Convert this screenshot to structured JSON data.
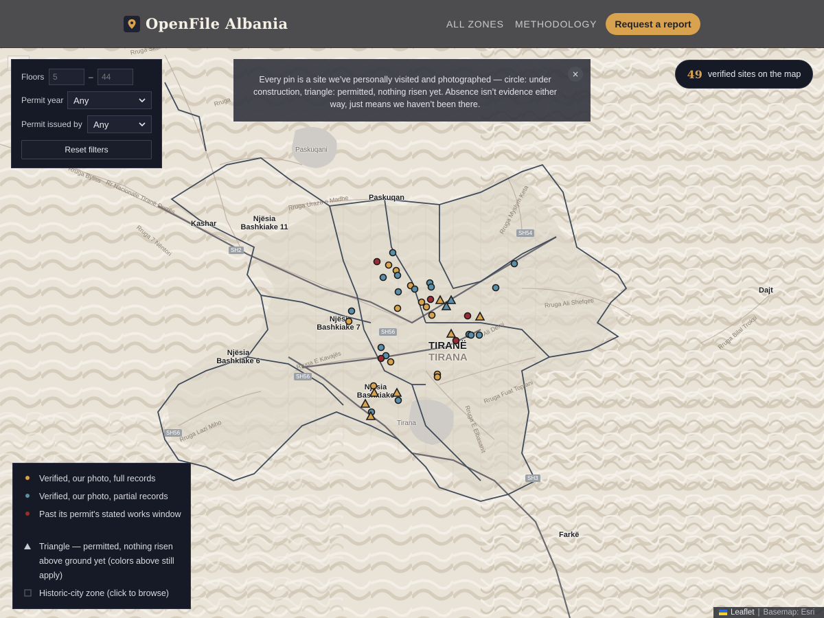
{
  "header": {
    "brand": "OpenFile Albania",
    "nav": [
      {
        "label": "ALL ZONES"
      },
      {
        "label": "METHODOLOGY"
      }
    ],
    "cta": "Request a report",
    "colors": {
      "bar": "#4d4d4f",
      "accent": "#d9a24e"
    }
  },
  "filters": {
    "floors_label": "Floors",
    "floors_min_placeholder": "5",
    "floors_sep": "–",
    "floors_max_placeholder": "44",
    "permit_year_label": "Permit year",
    "permit_year_value": "Any",
    "permit_issued_label": "Permit issued by",
    "permit_issued_value": "Any",
    "reset_label": "Reset filters"
  },
  "info": {
    "text": "Every pin is a site we’ve personally visited and photographed — circle: under construction, triangle: permitted, nothing risen yet. Absence isn’t evidence either way, just means we haven’t been there.",
    "close_icon": "×"
  },
  "count": {
    "value": "49",
    "label": "verified sites on the map"
  },
  "legend": {
    "items": [
      {
        "label": "Verified, our photo, full records",
        "symbol": "circle",
        "color": "#d9a24e"
      },
      {
        "label": "Verified, our photo, partial records",
        "symbol": "circle",
        "color": "#5b8fa8"
      },
      {
        "label": "Past its permit's stated works window",
        "symbol": "circle",
        "color": "#9b2c36"
      },
      {
        "label": "Triangle — permitted, nothing risen above ground yet (colors above still apply)",
        "symbol": "triangle",
        "color": "#c9cbd3"
      },
      {
        "label": "Historic-city zone (click to browse)",
        "symbol": "square",
        "color": "#2c3040"
      }
    ]
  },
  "map": {
    "places": [
      {
        "label": "Paskuqan"
      },
      {
        "label": "Kashar"
      },
      {
        "label": "Njësia Bashkiake 11"
      },
      {
        "label": "Njësi Bashkiake 7"
      },
      {
        "label": "Njësia Bashkiake 6"
      },
      {
        "label": "Njësia Bashkiake"
      },
      {
        "label": "TIRANË"
      },
      {
        "label": "TIRANA"
      },
      {
        "label": "Dajt"
      },
      {
        "label": "Farkë"
      },
      {
        "label": "Paskuqani"
      },
      {
        "label": "Tirana"
      }
    ],
    "roads": [
      {
        "label": "Rruga Skënde"
      },
      {
        "label": "Rruga"
      },
      {
        "label": "Rruga Byliss"
      },
      {
        "label": "Rr Nacionale Tiranë Durrës"
      },
      {
        "label": "Rruga 7 Nëntori"
      },
      {
        "label": "Rruga Uraza e Madhe"
      },
      {
        "label": "Rruga Myslym Keta"
      },
      {
        "label": "Rruga Ali Shefqeti"
      },
      {
        "label": "Rruga Bilal Troksi"
      },
      {
        "label": "Rruga E Kavajës"
      },
      {
        "label": "Rruga Lazi Miho"
      },
      {
        "label": "Rruga Fuat Toptani"
      },
      {
        "label": "Rruga E Elbasanit"
      },
      {
        "label": "Ali Demi"
      }
    ],
    "shields": [
      "SH54",
      "SH2",
      "SH56",
      "SH56",
      "SH56",
      "SH3"
    ],
    "pin_colors": {
      "full": "#d9a24e",
      "partial": "#5b8fa8",
      "past": "#9b2c36"
    }
  },
  "attribution": {
    "leaflet": "Leaflet",
    "sep": "|",
    "basemap": "Basemap: Esri"
  }
}
